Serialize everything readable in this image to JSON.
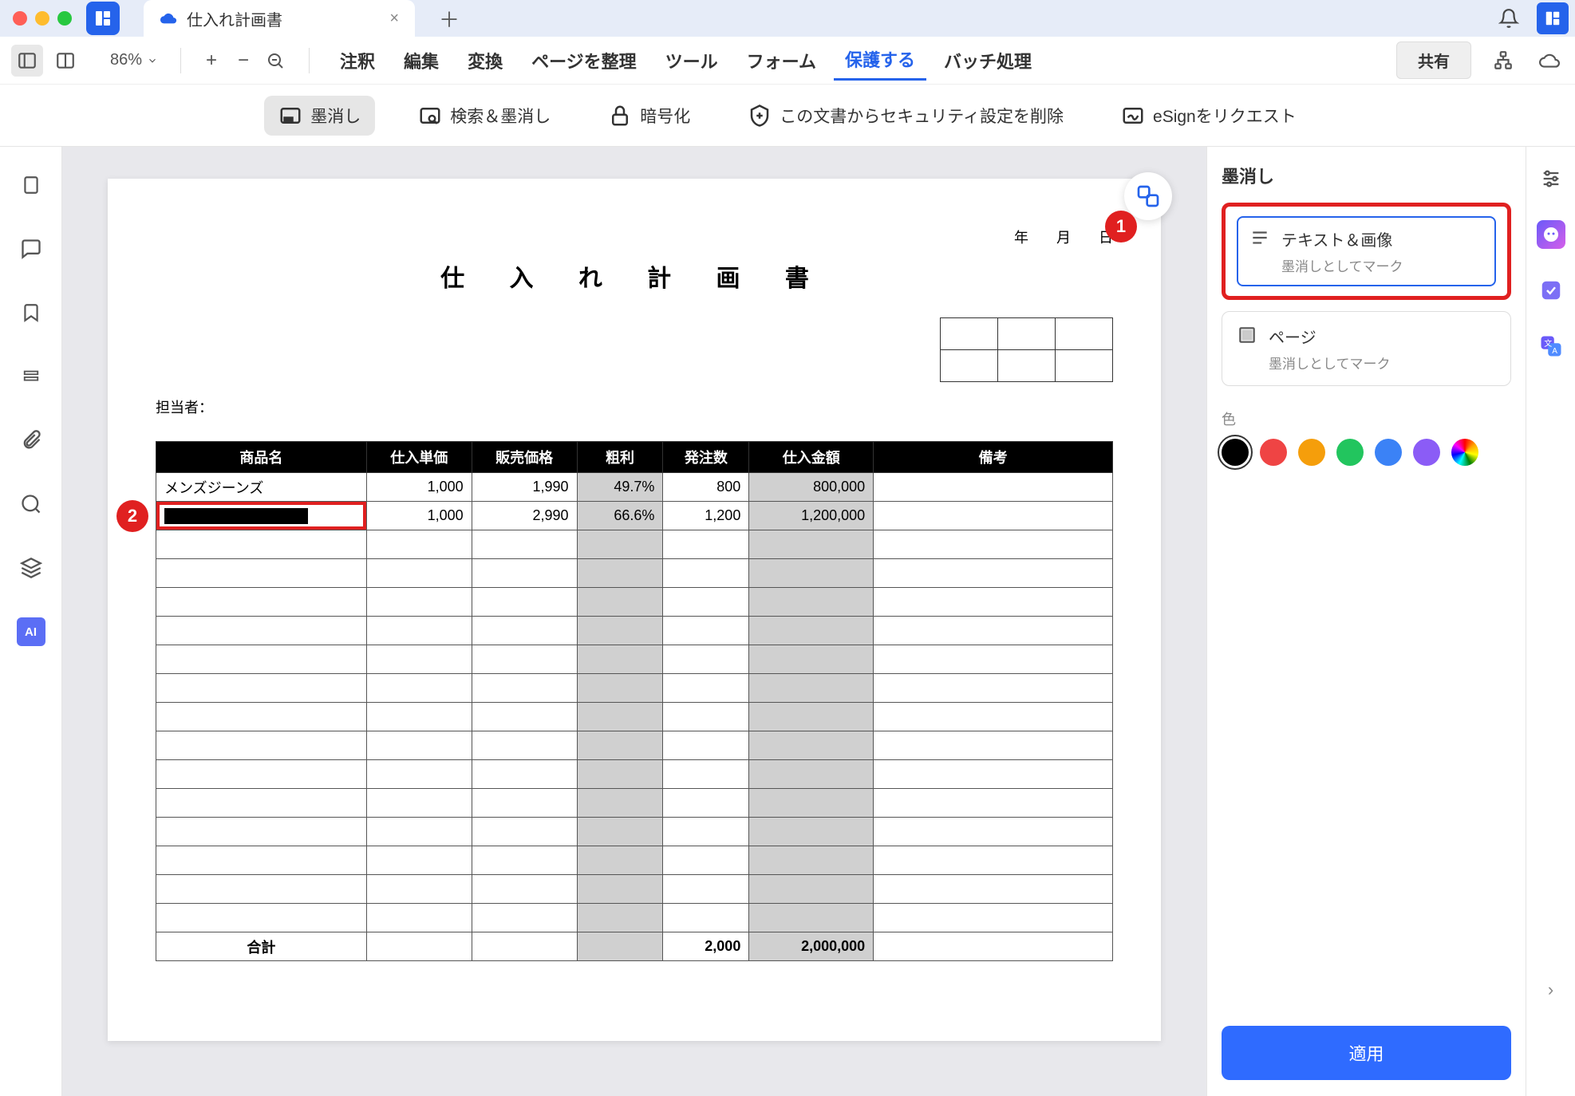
{
  "tab": {
    "title": "仕入れ計画書"
  },
  "toolbar": {
    "zoom": "86%",
    "menu": [
      "注釈",
      "編集",
      "変換",
      "ページを整理",
      "ツール",
      "フォーム",
      "保護する",
      "バッチ処理"
    ],
    "active_menu": 6,
    "share": "共有",
    "tools": {
      "redact": "墨消し",
      "search_redact": "検索＆墨消し",
      "encrypt": "暗号化",
      "remove_security": "この文書からセキュリティ設定を削除",
      "esign": "eSignをリクエスト"
    }
  },
  "doc": {
    "date_labels": {
      "y": "年",
      "m": "月",
      "d": "日"
    },
    "title": "仕 入 れ 計 画 書",
    "person_label": "担当者：",
    "headers": [
      "商品名",
      "仕入単価",
      "販売価格",
      "粗利",
      "発注数",
      "仕入金額",
      "備考"
    ],
    "rows": [
      {
        "name": "メンズジーンズ",
        "unit": "1,000",
        "price": "1,990",
        "margin": "49.7%",
        "qty": "800",
        "amount": "800,000",
        "note": ""
      },
      {
        "name": "__REDACTED__",
        "unit": "1,000",
        "price": "2,990",
        "margin": "66.6%",
        "qty": "1,200",
        "amount": "1,200,000",
        "note": ""
      }
    ],
    "total_label": "合計",
    "total_qty": "2,000",
    "total_amount": "2,000,000"
  },
  "panel": {
    "title": "墨消し",
    "opt1": {
      "title": "テキスト＆画像",
      "sub": "墨消しとしてマーク"
    },
    "opt2": {
      "title": "ページ",
      "sub": "墨消しとしてマーク"
    },
    "color_label": "色",
    "colors": [
      "#000000",
      "#ef4444",
      "#f59e0b",
      "#22c55e",
      "#3b82f6",
      "#8b5cf6",
      "conic"
    ],
    "apply": "適用"
  },
  "callouts": {
    "c1": "1",
    "c2": "2"
  }
}
